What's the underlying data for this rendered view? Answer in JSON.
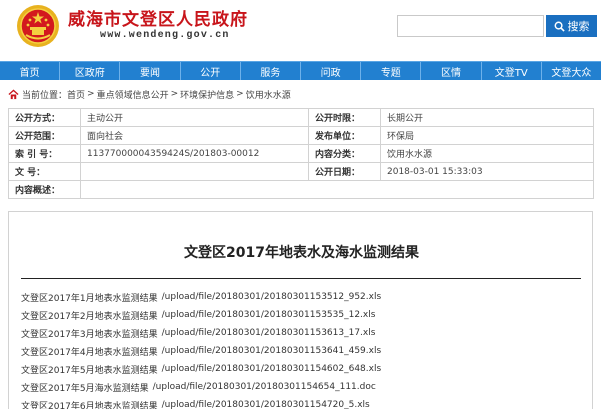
{
  "header": {
    "site_title": "威海市文登区人民政府",
    "site_url": "www.wendeng.gov.cn",
    "search": {
      "placeholder": "",
      "button_label": "搜索"
    },
    "brand_color": "#c8151b",
    "nav_color": "#2280d0"
  },
  "nav": {
    "items": [
      "首页",
      "区政府",
      "要闻",
      "公开",
      "服务",
      "问政",
      "专题",
      "区情",
      "文登TV",
      "文登大众"
    ]
  },
  "breadcrumb": {
    "label": "当前位置：",
    "items": [
      "首页",
      "重点领域信息公开",
      "环境保护信息",
      "饮用水水源"
    ],
    "separator": ">"
  },
  "meta": {
    "rows": [
      {
        "k1": "公开方式：",
        "v1": "主动公开",
        "k2": "公开时限：",
        "v2": "长期公开"
      },
      {
        "k1": "公开范围：",
        "v1": "面向社会",
        "k2": "发布单位：",
        "v2": "环保局"
      },
      {
        "k1": "索 引 号：",
        "v1": "11377000004359424S/201803-00012",
        "k2": "内容分类：",
        "v2": "饮用水水源"
      },
      {
        "k1": "文  号：",
        "v1": "",
        "k2": "公开日期：",
        "v2": "2018-03-01 15:33:03"
      },
      {
        "k1": "内容概述：",
        "v1": ""
      }
    ]
  },
  "document": {
    "title": "文登区2017年地表水及海水监测结果",
    "files": [
      {
        "name": "文登区2017年1月地表水监测结果",
        "path": "/upload/file/20180301/20180301153512_952.xls"
      },
      {
        "name": "文登区2017年2月地表水监测结果",
        "path": "/upload/file/20180301/20180301153535_12.xls"
      },
      {
        "name": "文登区2017年3月地表水监测结果",
        "path": "/upload/file/20180301/20180301153613_17.xls"
      },
      {
        "name": "文登区2017年4月地表水监测结果",
        "path": "/upload/file/20180301/20180301153641_459.xls"
      },
      {
        "name": "文登区2017年5月地表水监测结果",
        "path": "/upload/file/20180301/20180301154602_648.xls"
      },
      {
        "name": "文登区2017年5月海水监测结果",
        "path": "/upload/file/20180301/20180301154654_111.doc"
      },
      {
        "name": "文登区2017年6月地表水监测结果",
        "path": "/upload/file/20180301/20180301154720_5.xls"
      }
    ]
  }
}
